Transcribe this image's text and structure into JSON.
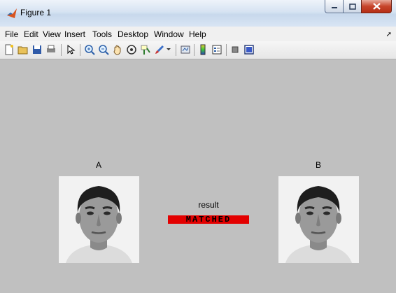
{
  "window": {
    "title": "Figure 1"
  },
  "menu": [
    "File",
    "Edit",
    "View",
    "Insert",
    "Tools",
    "Desktop",
    "Window",
    "Help"
  ],
  "toolbar_icons": [
    "new-figure-icon",
    "open-file-icon",
    "save-figure-icon",
    "print-figure-icon",
    "edit-plot-icon",
    "zoom-in-icon",
    "zoom-out-icon",
    "pan-icon",
    "rotate-3d-icon",
    "data-cursor-icon",
    "brush-icon",
    "link-plot-icon",
    "insert-colorbar-icon",
    "insert-legend-icon",
    "hide-plot-tools-icon",
    "show-plot-tools-icon"
  ],
  "figure": {
    "left_title": "A",
    "right_title": "B",
    "result_label": "result",
    "result_value": "MATCHED",
    "result_color": "#e30000"
  }
}
